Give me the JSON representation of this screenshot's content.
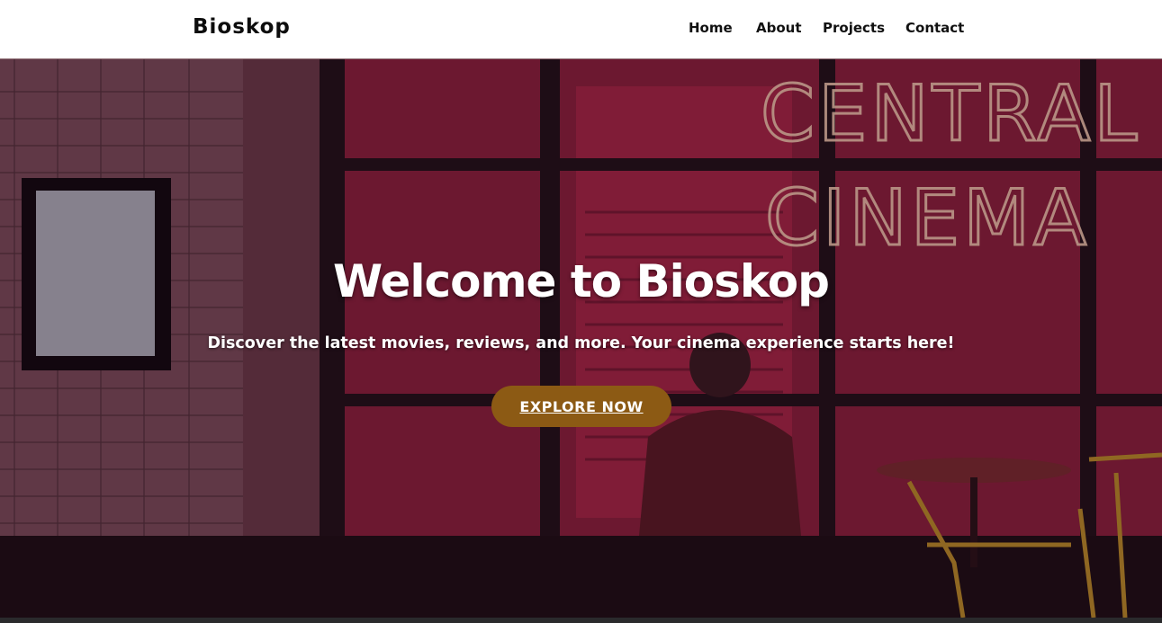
{
  "header": {
    "brand": "Bioskop",
    "nav": [
      "Home",
      "About",
      "Projects",
      "Contact"
    ]
  },
  "hero": {
    "title": "Welcome to Bioskop",
    "subtitle": "Discover the latest movies, reviews, and more. Your cinema experience starts here!",
    "cta_label": "EXPLORE NOW",
    "sign_line1": "CENTRAL",
    "sign_line2": "CINEMA"
  },
  "colors": {
    "header_bg": "#ffffff",
    "hero_tint": "#5a1c30",
    "neon": "#f2c7b0",
    "cta_bg": "#8c5a14",
    "text_light": "#ffffff"
  }
}
